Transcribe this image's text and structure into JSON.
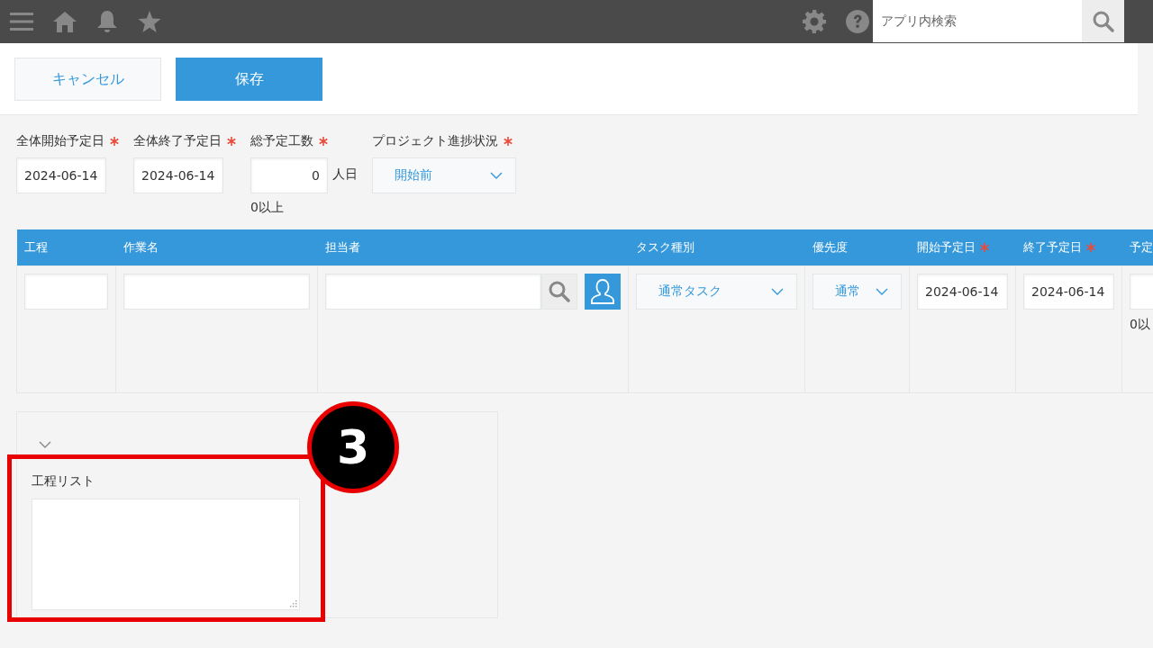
{
  "top_bar": {
    "search": {
      "placeholder": "アプリ内検索"
    }
  },
  "toolbar": {
    "buttons": [
      {
        "label": "キャンセル",
        "kind": "secondary"
      },
      {
        "label": "保存",
        "kind": "primary"
      }
    ]
  },
  "fields": [
    {
      "label": "全体開始予定日",
      "required": true,
      "kind": "date",
      "value": "2024-06-14"
    },
    {
      "label": "全体終了予定日",
      "required": true,
      "kind": "date",
      "value": "2024-06-14"
    },
    {
      "label": "総予定工数",
      "required": true,
      "kind": "number",
      "value": "0",
      "unit": "人日",
      "note": "0以上"
    },
    {
      "label": "プロジェクト進捗状況",
      "required": true,
      "kind": "dropdown",
      "value": "開始前"
    }
  ],
  "table": {
    "columns": [
      {
        "label": "工程",
        "required": false
      },
      {
        "label": "作業名",
        "required": false
      },
      {
        "label": "担当者",
        "required": false
      },
      {
        "label": "タスク種別",
        "required": false
      },
      {
        "label": "優先度",
        "required": false
      },
      {
        "label": "開始予定日",
        "required": true
      },
      {
        "label": "終了予定日",
        "required": true
      },
      {
        "label": "予定"
      }
    ],
    "rows": [
      [
        {
          "kind": "text"
        },
        {
          "kind": "text"
        },
        {
          "kind": "user"
        },
        {
          "kind": "dropdown",
          "value": "通常タスク"
        },
        {
          "kind": "dropdown",
          "value": "通常"
        },
        {
          "kind": "date",
          "value": "2024-06-14"
        },
        {
          "kind": "date",
          "value": "2024-06-14"
        },
        {
          "kind": "number",
          "note": "0以"
        }
      ]
    ]
  },
  "group": {
    "field": {
      "label": "工程リスト"
    }
  },
  "callout": {
    "number": "3"
  }
}
